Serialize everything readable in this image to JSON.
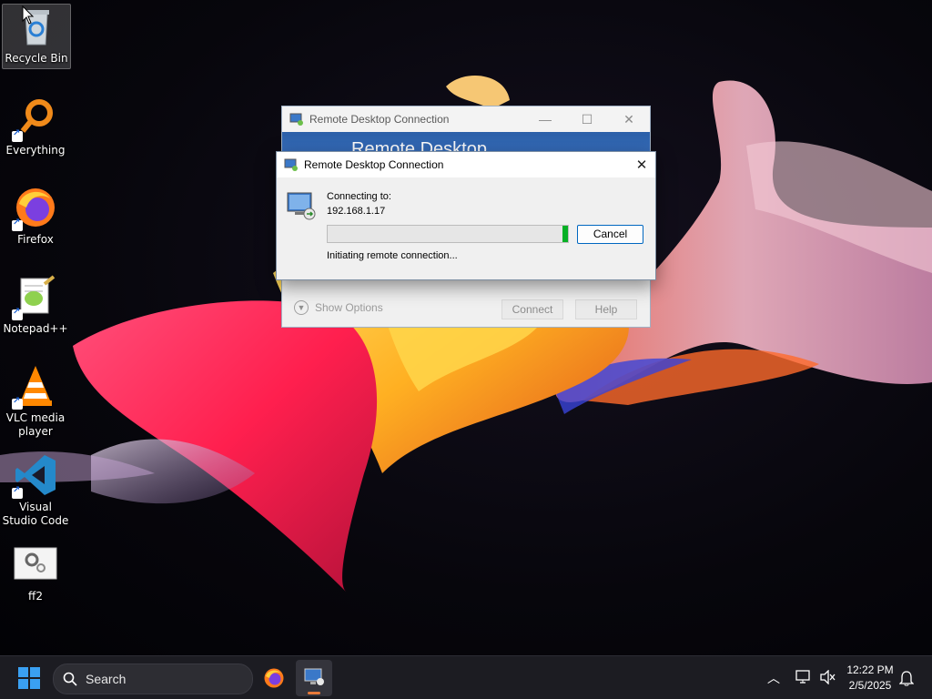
{
  "desktop_icons": [
    {
      "label": "Recycle Bin"
    },
    {
      "label": "Everything"
    },
    {
      "label": "Firefox"
    },
    {
      "label": "Notepad++"
    },
    {
      "label": "VLC media player"
    },
    {
      "label": "Visual Studio Code"
    },
    {
      "label": "ff2"
    }
  ],
  "back_window": {
    "title": "Remote Desktop Connection",
    "banner": "Remote Desktop",
    "show_options": "Show Options",
    "connect": "Connect",
    "help": "Help"
  },
  "dialog": {
    "title": "Remote Desktop Connection",
    "connecting_to": "Connecting to:",
    "address": "192.168.1.17",
    "status": "Initiating remote connection...",
    "cancel": "Cancel"
  },
  "taskbar": {
    "search_label": "Search",
    "time": "12:22 PM",
    "date": "2/5/2025"
  },
  "colors": {
    "progress": "#06b025",
    "accent": "#0067c0",
    "taskbar": "#1c1c22"
  }
}
